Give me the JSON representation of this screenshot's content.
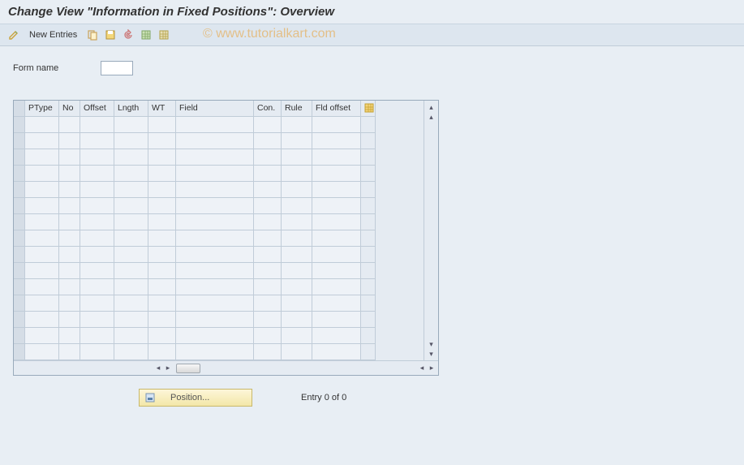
{
  "title": "Change View \"Information in Fixed Positions\": Overview",
  "toolbar": {
    "new_entries_label": "New Entries"
  },
  "watermark": "© www.tutorialkart.com",
  "form": {
    "form_name_label": "Form name",
    "form_name_value": ""
  },
  "table": {
    "columns": {
      "ptype": "PType",
      "no": "No",
      "offset": "Offset",
      "lngth": "Lngth",
      "wt": "WT",
      "field": "Field",
      "con": "Con.",
      "rule": "Rule",
      "fld_offset": "Fld offset"
    },
    "row_count": 15
  },
  "footer": {
    "position_label": "Position...",
    "entry_text": "Entry 0 of 0"
  }
}
